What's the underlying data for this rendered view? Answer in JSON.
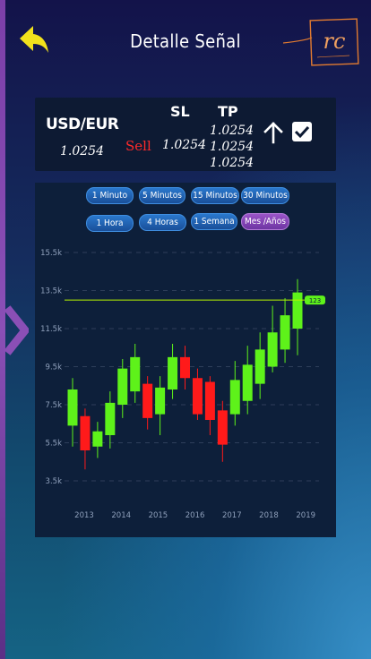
{
  "header": {
    "title": "Detalle Señal",
    "logo_text": "rc"
  },
  "signal": {
    "pair": "USD/EUR",
    "pair_price": "1.0254",
    "direction": "Sell",
    "sl_label": "SL",
    "tp_label": "TP",
    "sl_value": "1.0254",
    "tp_values": [
      "1.0254",
      "1.0254",
      "1.0254"
    ],
    "checked": true
  },
  "timeframes": [
    {
      "label": "1 Minuto",
      "active": false
    },
    {
      "label": "5 Minutos",
      "active": false
    },
    {
      "label": "15 Minutos",
      "active": false
    },
    {
      "label": "30 Minutos",
      "active": false
    },
    {
      "label": "1 Hora",
      "active": false
    },
    {
      "label": "4 Horas",
      "active": false
    },
    {
      "label": "1 Semana",
      "active": false
    },
    {
      "label": "Mes /Años",
      "active": true
    }
  ],
  "colors": {
    "up": "#5ef21a",
    "down": "#ff1a1a",
    "accent": "#f2e21c",
    "marker_line": "#b6f200"
  },
  "chart_data": {
    "type": "candlestick",
    "y_ticks": [
      "15.5k",
      "13.5k",
      "11.5k",
      "9.5k",
      "7.5k",
      "5.5k",
      "3.5k"
    ],
    "y_tick_values": [
      15500,
      13500,
      11500,
      9500,
      7500,
      5500,
      3500
    ],
    "ylim": [
      3500,
      15500
    ],
    "x_ticks": [
      "2013",
      "2014",
      "2015",
      "2016",
      "2017",
      "2018",
      "2019"
    ],
    "price_line_value": 13000,
    "price_label": "123",
    "grid": true,
    "candles": [
      {
        "o": 6400,
        "c": 8300,
        "h": 8900,
        "l": 5300
      },
      {
        "o": 6900,
        "c": 5100,
        "h": 7300,
        "l": 4100
      },
      {
        "o": 5300,
        "c": 6100,
        "h": 6600,
        "l": 4700
      },
      {
        "o": 5900,
        "c": 7600,
        "h": 8200,
        "l": 5200
      },
      {
        "o": 7500,
        "c": 9400,
        "h": 9900,
        "l": 6800
      },
      {
        "o": 8200,
        "c": 10000,
        "h": 10700,
        "l": 7600
      },
      {
        "o": 8600,
        "c": 6800,
        "h": 9000,
        "l": 6200
      },
      {
        "o": 7000,
        "c": 8400,
        "h": 9000,
        "l": 5900
      },
      {
        "o": 8300,
        "c": 10000,
        "h": 10700,
        "l": 7800
      },
      {
        "o": 10000,
        "c": 8900,
        "h": 10600,
        "l": 8300
      },
      {
        "o": 8900,
        "c": 7000,
        "h": 9400,
        "l": 6700
      },
      {
        "o": 8700,
        "c": 6700,
        "h": 9000,
        "l": 5900
      },
      {
        "o": 7200,
        "c": 5400,
        "h": 7700,
        "l": 4500
      },
      {
        "o": 7000,
        "c": 8800,
        "h": 9800,
        "l": 6400
      },
      {
        "o": 7700,
        "c": 9600,
        "h": 10600,
        "l": 7000
      },
      {
        "o": 8600,
        "c": 10400,
        "h": 11300,
        "l": 7800
      },
      {
        "o": 9500,
        "c": 11300,
        "h": 12700,
        "l": 9200
      },
      {
        "o": 10400,
        "c": 12200,
        "h": 13100,
        "l": 9700
      },
      {
        "o": 11500,
        "c": 13400,
        "h": 14100,
        "l": 10100
      }
    ]
  }
}
